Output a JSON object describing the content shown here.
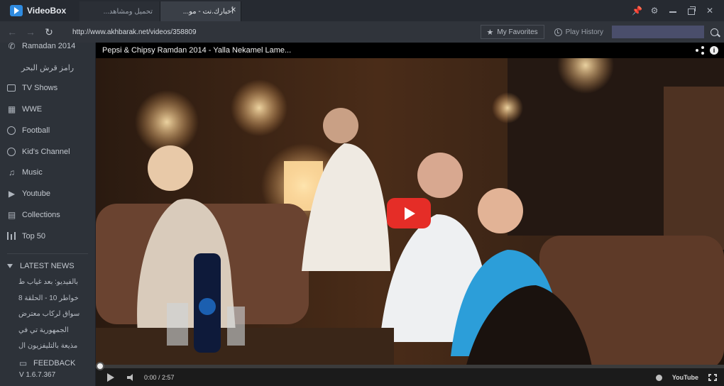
{
  "app": {
    "name": "VideoBox",
    "brand_color": "#2f8be0"
  },
  "tabs": [
    {
      "label": "تحميل ومشاهد...",
      "active": false
    },
    {
      "label": "أخبارك.نت - مو...",
      "active": true
    }
  ],
  "address_bar": {
    "url": "http://www.akhbarak.net/videos/358809",
    "favorites_label": "My Favorites",
    "history_label": "Play History",
    "search_value": ""
  },
  "sidebar": {
    "items": [
      {
        "label": "Ramadan 2014",
        "icon": "phone-icon"
      },
      {
        "label": "رامز قرش البحر",
        "icon": ""
      },
      {
        "label": "TV Shows",
        "icon": "tv-icon"
      },
      {
        "label": "WWE",
        "icon": "grid-icon"
      },
      {
        "label": "Football",
        "icon": "football-icon"
      },
      {
        "label": "Kid's Channel",
        "icon": "globe-icon"
      },
      {
        "label": "Music",
        "icon": "music-icon"
      },
      {
        "label": "Youtube",
        "icon": "play-box-icon"
      },
      {
        "label": "Collections",
        "icon": "collections-icon"
      },
      {
        "label": "Top 50",
        "icon": "bar-chart-icon"
      }
    ],
    "news_header": "LATEST NEWS",
    "news": [
      "بالفيديو: بعد غياب ط",
      "خواطر 10 - الحلقة 8",
      "سواق لركاب معترض",
      "الجمهورية تي في",
      "مذيعة بالتليفزيون ال"
    ],
    "feedback_label": "FEEDBACK",
    "version": "V  1.6.7.367"
  },
  "player": {
    "title": "Pepsi & Chipsy Ramdan 2014 - Yalla Nekamel Lame...",
    "current_time": "0:00",
    "duration": "2:57",
    "progress_fraction": 0.0,
    "accent_color": "#e52d27",
    "youtube_label": "YouTube"
  }
}
